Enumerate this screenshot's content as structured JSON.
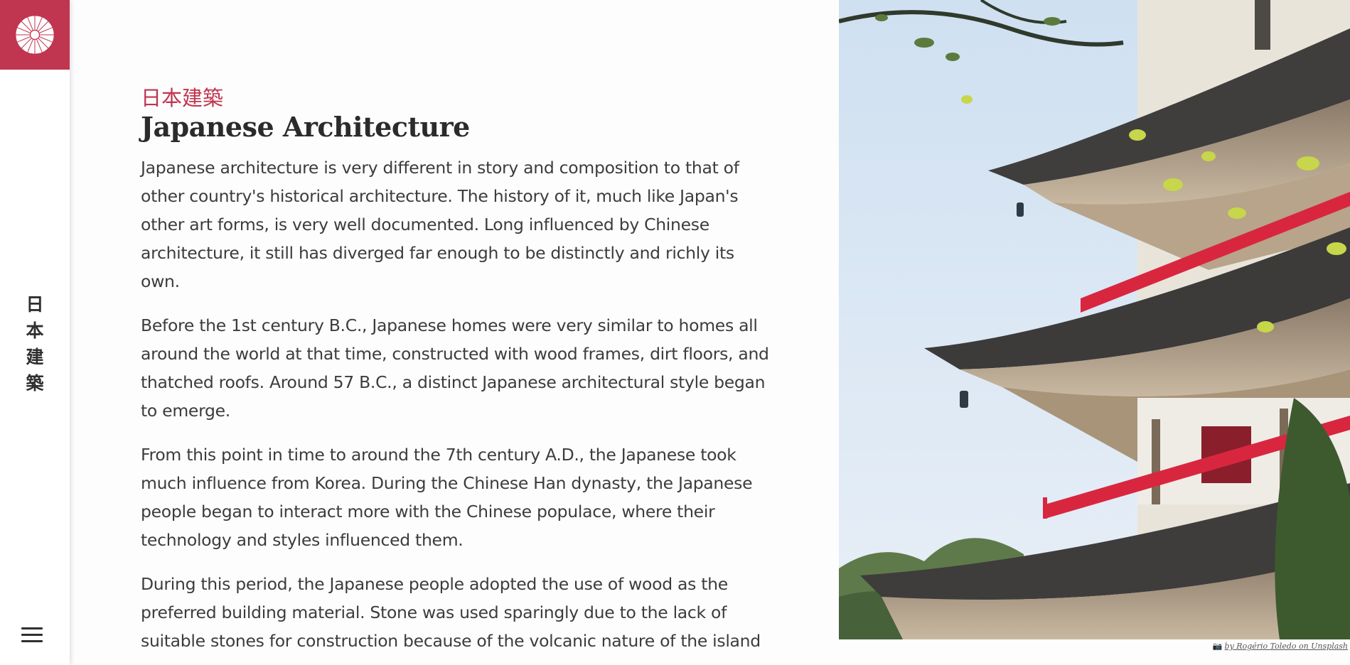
{
  "sidebar": {
    "logo_icon": "chrysanthemum-icon",
    "vertical_title": [
      "日",
      "本",
      "建",
      "築"
    ],
    "menu_icon": "hamburger-menu-icon"
  },
  "article": {
    "kanji_title": "日本建築",
    "title": "Japanese Architecture",
    "paragraphs": [
      "Japanese architecture is very different in story and composition to that of other country's historical architecture. The history of it, much like Japan's other art forms, is very well documented. Long influenced by Chinese architecture, it still has diverged far enough to be distinctly and richly its own.",
      "Before the 1st century B.C., Japanese homes were very similar to homes all around the world at that time, constructed with wood frames, dirt floors, and thatched roofs. Around 57 B.C., a distinct Japanese architectural style began to emerge.",
      "From this point in time to around the 7th century A.D., the Japanese took much influence from Korea. During the Chinese Han dynasty, the Japanese people began to interact more with the Chinese populace, where their technology and styles influenced them.",
      "During this period, the Japanese people adopted the use of wood as the preferred building material. Stone was used sparingly due to the lack of suitable stones for construction because of the volcanic nature of the island"
    ]
  },
  "photo": {
    "subject": "pagoda-photo",
    "credit": "by Rogério Toledo on Unsplash",
    "credit_icon": "camera-icon"
  },
  "colors": {
    "accent": "#c0354f",
    "text": "#3c3c3c",
    "sky": "#dbe7f3",
    "railing": "#d9263f"
  }
}
